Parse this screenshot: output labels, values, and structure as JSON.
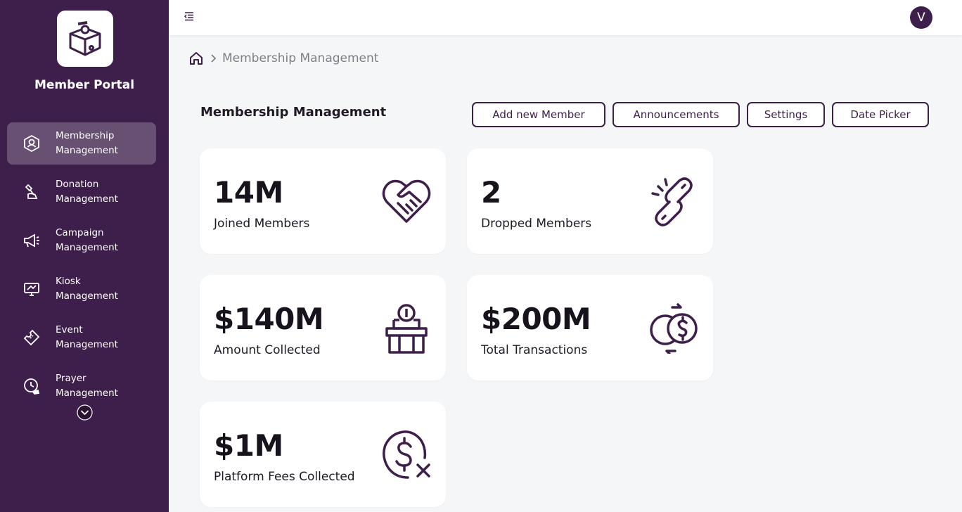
{
  "app": {
    "title": "Member Portal"
  },
  "sidebar": {
    "items": [
      {
        "label": "Membership\nManagement",
        "icon": "membership-icon",
        "active": true
      },
      {
        "label": "Donation\nManagement",
        "icon": "donation-icon",
        "active": false
      },
      {
        "label": "Campaign\nManagement",
        "icon": "megaphone-icon",
        "active": false
      },
      {
        "label": "Kiosk\nManagement",
        "icon": "kiosk-icon",
        "active": false
      },
      {
        "label": "Event\nManagement",
        "icon": "ticket-icon",
        "active": false
      },
      {
        "label": "Prayer\nManagement",
        "icon": "clock-hand-icon",
        "active": false
      }
    ]
  },
  "topbar": {
    "avatar_initial": "V"
  },
  "breadcrumb": {
    "current": "Membership Management"
  },
  "page": {
    "title": "Membership Management",
    "buttons": {
      "add_member": "Add new Member",
      "announcements": "Announcements",
      "settings": "Settings",
      "date_picker": "Date Picker"
    }
  },
  "stats": [
    {
      "value": "14M",
      "label": "Joined Members",
      "icon": "heart-handshake-icon"
    },
    {
      "value": "2",
      "label": "Dropped Members",
      "icon": "broken-link-icon"
    },
    {
      "value": "$140M",
      "label": "Amount Collected",
      "icon": "donation-box-icon"
    },
    {
      "value": "$200M",
      "label": "Total Transactions",
      "icon": "coins-exchange-icon"
    },
    {
      "value": "$1M",
      "label": "Platform Fees Collected",
      "icon": "dollar-cross-icon"
    }
  ],
  "colors": {
    "brand": "#3e1f4b",
    "background": "#f5f6f8",
    "card": "#ffffff"
  }
}
